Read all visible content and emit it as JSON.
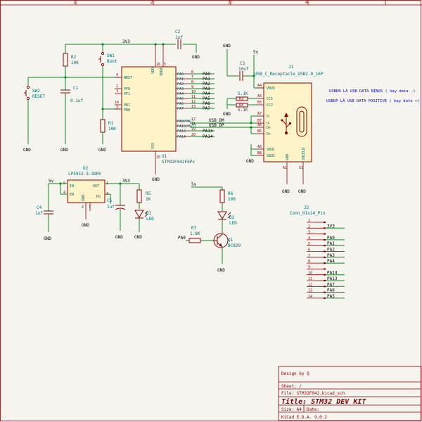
{
  "frame": {
    "cols": [
      "1",
      "2",
      "3",
      "4"
    ]
  },
  "nets": {
    "v3_top": "3V3",
    "v5_j1": "5v",
    "v5_reg": "5v",
    "v3_reg": "3V3",
    "v5_q": "5v",
    "gnd": "GND",
    "pa0": "PA0",
    "pa1": "PA1",
    "pa2": "PA2",
    "pa3": "PA3",
    "pa4": "PA4",
    "pa5": "PA5",
    "pa6": "PA6",
    "pa7": "PA7",
    "pa13": "PA13",
    "pa14": "PA14",
    "usbdm": "USB_DM",
    "usbdp": "USB_DP",
    "pa0_q": "PA0",
    "j2_3v3": "3V3",
    "j2_pa0": "PA0",
    "j2_pa1": "PA1",
    "j2_pa2": "PA2",
    "j2_pa3": "PA3",
    "j2_pa4": "PA4",
    "j2_pa14": "PA14",
    "j2_pa13": "PA13",
    "j2_pa7": "PA7",
    "j2_pa6": "PA6",
    "j2_pa5": "PA5"
  },
  "components": {
    "r2": {
      "ref": "R2",
      "value": "10K"
    },
    "sw1": {
      "ref": "SW1",
      "value": "Boot"
    },
    "sw2": {
      "ref": "SW2",
      "value": "RESET"
    },
    "c1": {
      "ref": "C1",
      "value": "0.1uf"
    },
    "r1": {
      "ref": "R1",
      "value": "10K"
    },
    "c2": {
      "ref": "C2",
      "value": "1uf"
    },
    "c3": {
      "ref": "C3",
      "value": "10uf"
    },
    "u1": {
      "ref": "U1",
      "value": "STM32F042F6Px"
    },
    "j1": {
      "ref": "J1",
      "value": "USB_C_Receptacle_USB2.0_16P"
    },
    "r3": {
      "ref": "R3",
      "value": "5.1K"
    },
    "r4": {
      "ref": "R4",
      "value": "5.1K"
    },
    "u2": {
      "ref": "U2",
      "value": "LP5912-3.3DRV"
    },
    "c4": {
      "ref": "C4",
      "value": "1uf"
    },
    "c5": {
      "ref": "C5",
      "value": "1uf"
    },
    "r5": {
      "ref": "R5",
      "value": "1K"
    },
    "d1": {
      "ref": "D1",
      "value": "LED"
    },
    "r6": {
      "ref": "R6",
      "value": "100"
    },
    "d2": {
      "ref": "D2",
      "value": "LED"
    },
    "r7": {
      "ref": "R7",
      "value": "1.8K"
    },
    "q1": {
      "ref": "Q1",
      "value": "BC829"
    },
    "j2": {
      "ref": "J2",
      "value": "Conn_01x14_Pin"
    }
  },
  "u1_pins": {
    "nrst": "NRST",
    "pf0": "PF0",
    "pf1": "PF1",
    "pb1": "PB1",
    "pb8": "PB8",
    "vdd": "VDD",
    "vdda": "VDDA",
    "vss": "VSS",
    "right": [
      "PA0",
      "PA1",
      "PA2",
      "PA3",
      "PA4",
      "PA5",
      "PA6",
      "PA7",
      "PA9/PA11",
      "PA10/PA12",
      "PA13",
      "PA14"
    ],
    "right_nums": [
      "6",
      "7",
      "8",
      "9",
      "10",
      "11",
      "12",
      "13",
      "17",
      "18",
      "19",
      "20"
    ],
    "left_nums": [
      "4",
      "2",
      "3",
      "14",
      "1"
    ],
    "vdd_nums": [
      "16",
      "5"
    ],
    "vss_num": "15"
  },
  "j1_pins": {
    "vbus": "VBUS",
    "cc1": "CC1",
    "cc2": "CC2",
    "dm1": "D-",
    "dm2": "D-",
    "dp1": "D+",
    "dp2": "D+",
    "sbu1": "SBU1",
    "sbu2": "SBU2",
    "gnd": "GND",
    "shield": "SHIELD",
    "nums": [
      "A4",
      "A5",
      "B5",
      "A7",
      "B7",
      "A6",
      "B6",
      "A8",
      "B8",
      "A1",
      "S1"
    ]
  },
  "u2_pins": {
    "in": "IN",
    "en": "EN",
    "out": "OUT",
    "pg": "PG",
    "gnd": "GND",
    "nums": [
      "6",
      "4",
      "1",
      "3",
      "2",
      "7"
    ]
  },
  "j2_pins": [
    "1",
    "2",
    "3",
    "4",
    "5",
    "6",
    "7",
    "8",
    "9",
    "10",
    "11",
    "12",
    "13",
    "14"
  ],
  "notes": {
    "usbdn": "USBDN LÀ USB DATA NINUS ( hay data -)",
    "usbdp": "USBDP LÀ USB DATA POSITIVE ( hay date +)"
  },
  "title_block": {
    "design_by": "Design by Q",
    "sheet": "Sheet: /",
    "file": "File: STM32F042.kicad_sch",
    "title": "Title: STM32 DEV KIT",
    "size": "Size: A4",
    "date": "Date:",
    "kicad": "KiCad E.D.A. 9.0.2"
  }
}
